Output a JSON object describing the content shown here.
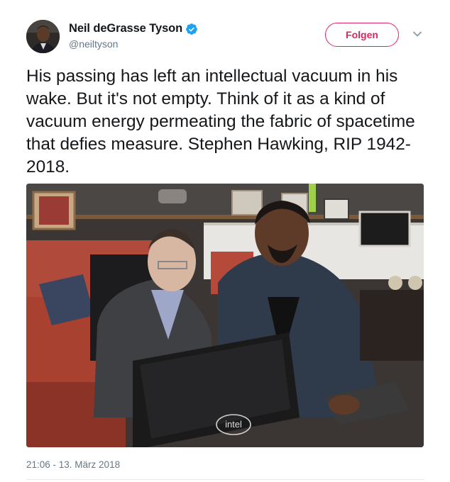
{
  "user": {
    "display_name": "Neil deGrasse Tyson",
    "handle": "@neiltyson",
    "verified_icon": "verified-badge-icon",
    "avatar_icon": "avatar"
  },
  "actions": {
    "follow_label": "Folgen",
    "menu_icon": "chevron-down-icon"
  },
  "tweet": {
    "text": "His passing has left an intellectual vacuum in his wake. But it's not empty. Think of it as a kind of vacuum energy permeating the fabric of spacetime that defies measure. Stephen Hawking, RIP 1942-2018.",
    "timestamp": "21:06 - 13. März 2018"
  },
  "photo": {
    "laptop_brand": "intel"
  },
  "colors": {
    "accent": "#e0245e",
    "verified": "#1da1f2",
    "secondary_text": "#657786",
    "divider": "#e6ecf0"
  }
}
